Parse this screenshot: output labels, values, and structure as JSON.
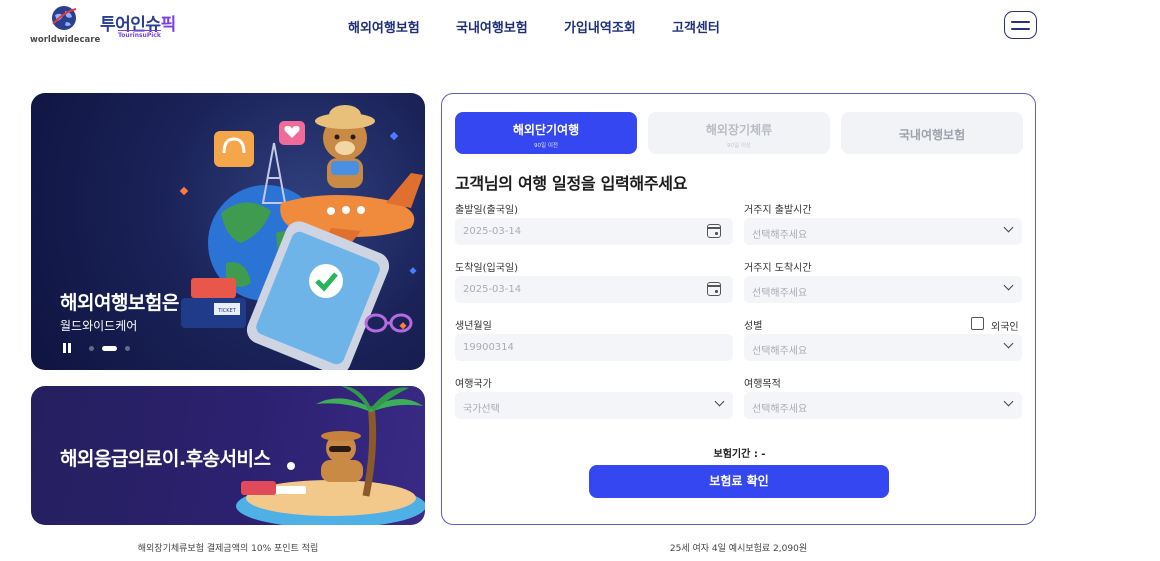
{
  "header": {
    "logo_text": "worldwidecare",
    "brand_ko": "투어인슈",
    "brand_ko_accent": "픽",
    "brand_en": "TourinsuPick",
    "nav": [
      "해외여행보험",
      "국내여행보험",
      "가입내역조회",
      "고객센터"
    ]
  },
  "banners": {
    "main_title": "해외여행보험은",
    "main_subtitle": "월드와이드케어",
    "main_ticket_text": "TICKET",
    "carousel_active_index": 2,
    "carousel_count": 3,
    "second_title": "해외응급의료이.후송서비스"
  },
  "captions": {
    "left": "해외장기체류보험 결제금액의 10% 포인트 적립",
    "right": "25세 여자 4일 예시보험료 2,090원"
  },
  "form": {
    "tabs": [
      {
        "label": "해외단기여행",
        "sub": "90일 이전",
        "active": true
      },
      {
        "label": "해외장기체류",
        "sub": "90일 이상",
        "active": false
      },
      {
        "label": "국내여행보험",
        "sub": "",
        "active": false
      }
    ],
    "title": "고객님의 여행 일정을 입력해주세요",
    "departure_date": {
      "label": "출발일(출국일)",
      "value": "2025-03-14"
    },
    "departure_time": {
      "label": "거주지 출발시간",
      "placeholder": "선택해주세요"
    },
    "arrival_date": {
      "label": "도착일(입국일)",
      "value": "2025-03-14"
    },
    "arrival_time": {
      "label": "거주지 도착시간",
      "placeholder": "선택해주세요"
    },
    "birthdate": {
      "label": "생년월일",
      "placeholder": "19900314"
    },
    "gender": {
      "label": "성별",
      "placeholder": "선택해주세요"
    },
    "foreigner": {
      "label": "외국인",
      "checked": false
    },
    "country": {
      "label": "여행국가",
      "placeholder": "국가선택"
    },
    "purpose": {
      "label": "여행목적",
      "placeholder": "선택해주세요"
    },
    "period_label": "보험기간 : -",
    "confirm_label": "보험료 확인"
  },
  "colors": {
    "accent": "#3547f0",
    "nav_text": "#1f2f7a",
    "panel_border": "#5a5fb8",
    "banner_dark": "#1a2258"
  }
}
